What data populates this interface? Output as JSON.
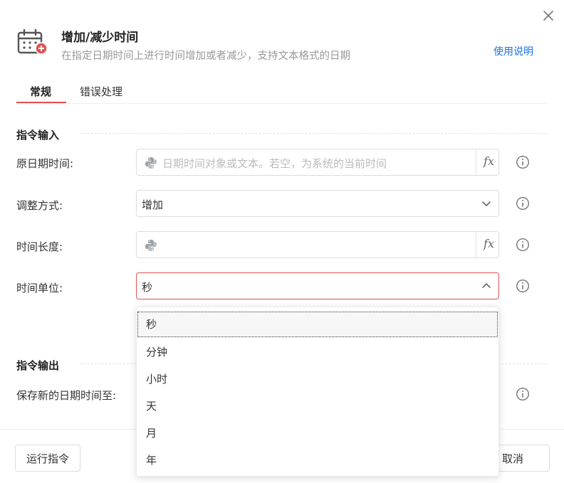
{
  "header": {
    "title": "增加/减少时间",
    "subtitle": "在指定日期时间上进行时间增加或者减少，支持文本格式的日期",
    "help_link": "使用说明",
    "icon": "calendar-plus-icon",
    "accent_color": "#e05252",
    "link_color": "#1a73e8"
  },
  "tabs": [
    {
      "label": "常规",
      "active": true
    },
    {
      "label": "错误处理",
      "active": false
    }
  ],
  "input_section": {
    "title": "指令输入",
    "fields": [
      {
        "label": "原日期时间:",
        "type": "expression",
        "value": "",
        "placeholder": "日期时间对象或文本。若空，为系统的当前时间",
        "fx": "fx"
      },
      {
        "label": "调整方式:",
        "type": "select",
        "value": "增加"
      },
      {
        "label": "时间长度:",
        "type": "expression",
        "value": "",
        "placeholder": "",
        "fx": "fx"
      },
      {
        "label": "时间单位:",
        "type": "select",
        "value": "秒",
        "open": true
      }
    ]
  },
  "output_section": {
    "title": "指令输出",
    "fields": [
      {
        "label": "保存新的日期时间至:"
      }
    ]
  },
  "dropdown": {
    "options": [
      "秒",
      "分钟",
      "小时",
      "天",
      "月",
      "年"
    ],
    "selected": "秒"
  },
  "footer": {
    "run_label": "运行指令",
    "cancel_label": "取消"
  }
}
